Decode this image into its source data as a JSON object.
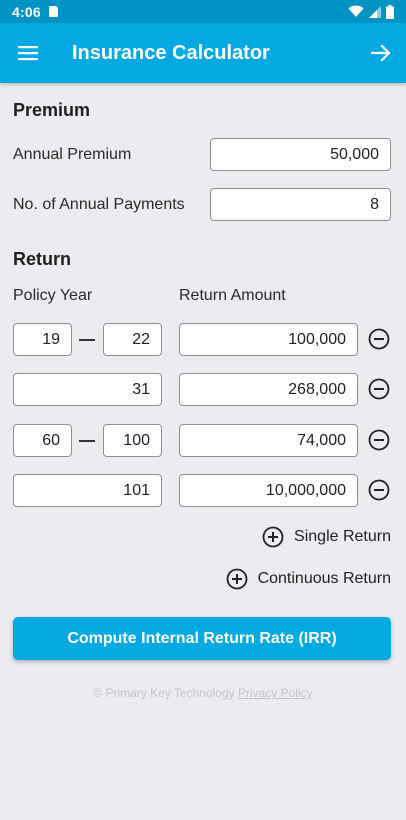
{
  "status": {
    "time": "4:06",
    "icons": [
      "sd-card-icon",
      "wifi-icon",
      "signal-icon",
      "battery-icon"
    ]
  },
  "appbar": {
    "title": "Insurance Calculator",
    "menu_icon": "hamburger-icon",
    "forward_icon": "arrow-right-icon"
  },
  "premium": {
    "heading": "Premium",
    "annual_premium_label": "Annual Premium",
    "annual_premium_value": "50,000",
    "payments_label": "No. of Annual Payments",
    "payments_value": "8"
  },
  "return_section": {
    "heading": "Return",
    "col_year": "Policy Year",
    "col_amount": "Return Amount",
    "rows": [
      {
        "from": "19",
        "to": "22",
        "amount": "100,000"
      },
      {
        "year": "31",
        "amount": "268,000"
      },
      {
        "from": "60",
        "to": "100",
        "amount": "74,000"
      },
      {
        "year": "101",
        "amount": "10,000,000"
      }
    ]
  },
  "actions": {
    "single_return": "Single Return",
    "continuous_return": "Continuous Return",
    "compute": "Compute Internal Return Rate (IRR)"
  },
  "footer": {
    "copyright": "© Primary Key Technology",
    "privacy": "Privacy Policy"
  },
  "colors": {
    "appbar": "#03a9e0",
    "statusbar": "#0093c4",
    "background": "#ececf0",
    "button": "#03a9e0"
  }
}
